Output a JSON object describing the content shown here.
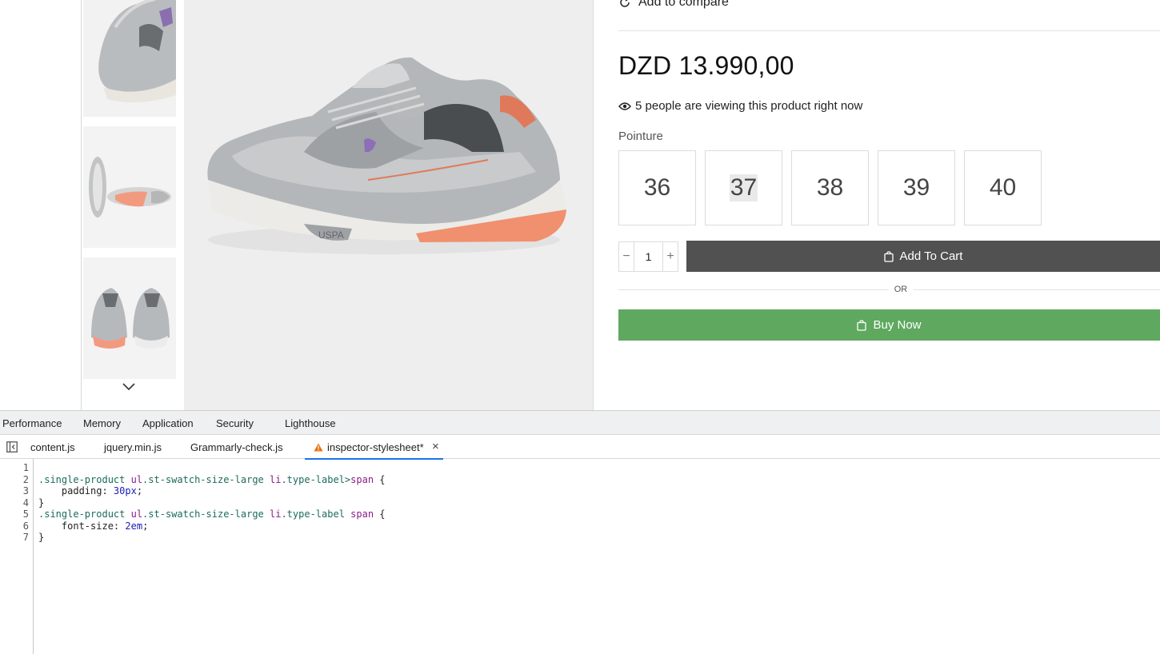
{
  "product": {
    "compare_label": "Add to compare",
    "price": "DZD 13.990,00",
    "viewers_text": "5 people are viewing this product right now",
    "size_label": "Pointure",
    "sizes": [
      "36",
      "37",
      "38",
      "39",
      "40"
    ],
    "quantity": "1",
    "qty_minus": "−",
    "qty_plus": "+",
    "add_to_cart": "Add To Cart",
    "or_text": "OR",
    "buy_now": "Buy Now"
  },
  "colors": {
    "add_to_cart_bg": "#515151",
    "buy_now_bg": "#5fa85f"
  },
  "devtools": {
    "panel_tabs": [
      "Performance",
      "Memory",
      "Application",
      "Security",
      "Lighthouse"
    ],
    "file_tabs": [
      "content.js",
      "jquery.min.js",
      "Grammarly-check.js",
      "inspector-stylesheet*"
    ],
    "close_symbol": "×",
    "line_numbers": [
      "1",
      "2",
      "3",
      "4",
      "5",
      "6",
      "7"
    ],
    "code": {
      "l2": {
        "sel_a": ".single-product ",
        "tag_a": "ul",
        "sel_b": ".st-swatch-size-large ",
        "tag_b": "li",
        "sel_c": ".type-label>",
        "tag_c": "span",
        "brace": " {"
      },
      "l3": {
        "prop": "    padding: ",
        "val": "30px",
        "end": ";"
      },
      "l4": "}",
      "l5": {
        "sel_a": ".single-product ",
        "tag_a": "ul",
        "sel_b": ".st-swatch-size-large ",
        "tag_b": "li",
        "sel_c": ".type-label ",
        "tag_c": "span",
        "brace": " {"
      },
      "l6": {
        "prop": "    font-size: ",
        "val": "2em",
        "end": ";"
      },
      "l7": "}"
    }
  }
}
